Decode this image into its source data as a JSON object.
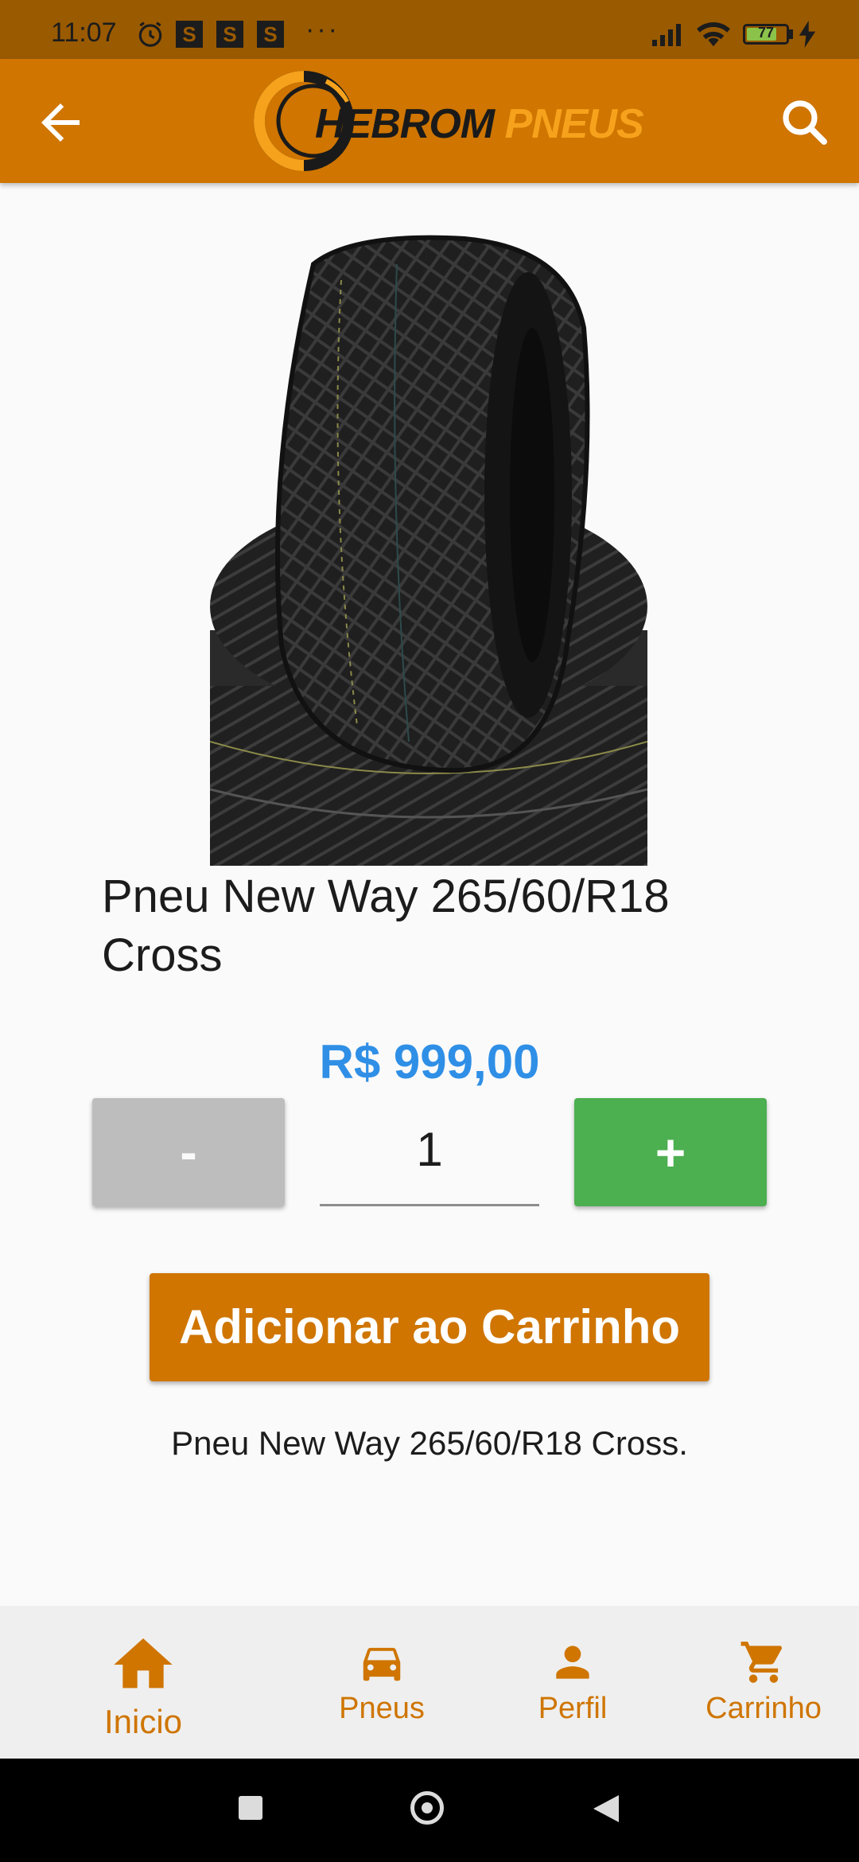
{
  "status_bar": {
    "time": "11:07",
    "badges": [
      "S",
      "S",
      "S"
    ],
    "more": "···",
    "battery": "77",
    "battery_level": 0.77
  },
  "app_bar": {
    "logo_word_1": "HEBROM",
    "logo_word_2": "PNEUS",
    "back_icon": "arrow-left-icon",
    "search_icon": "search-icon"
  },
  "product": {
    "title": "Pneu New Way 265/60/R18 Cross",
    "price": "R$ 999,00",
    "quantity": "1",
    "minus_label": "-",
    "plus_label": "+",
    "add_to_cart_label": "Adicionar ao Carrinho",
    "description": "Pneu New Way 265/60/R18 Cross."
  },
  "bottom_nav": {
    "items": [
      {
        "label": "Inicio",
        "icon": "home-icon"
      },
      {
        "label": "Pneus",
        "icon": "car-icon"
      },
      {
        "label": "Perfil",
        "icon": "person-icon"
      },
      {
        "label": "Carrinho",
        "icon": "cart-icon"
      }
    ]
  },
  "colors": {
    "primary": "#cf7500",
    "status_bar": "#9a5a00",
    "price": "#2f8fe6",
    "plus_button": "#4caf50",
    "minus_button": "#bdbdbd",
    "logo_accent": "#f7a21c"
  }
}
